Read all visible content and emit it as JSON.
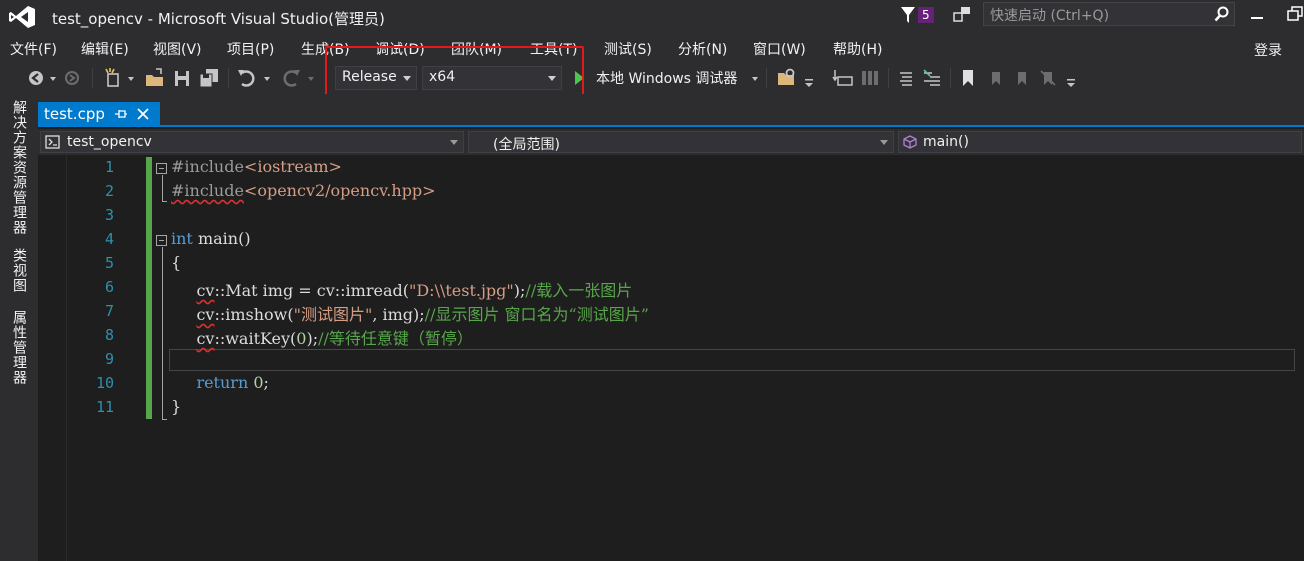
{
  "window": {
    "title": "test_opencv - Microsoft Visual Studio(管理员)",
    "notification_count": "5",
    "quick_launch_placeholder": "快速启动 (Ctrl+Q)"
  },
  "menu": {
    "items": [
      "文件(F)",
      "编辑(E)",
      "视图(V)",
      "项目(P)",
      "生成(B)",
      "调试(D)",
      "团队(M)",
      "工具(T)",
      "测试(S)",
      "分析(N)",
      "窗口(W)",
      "帮助(H)"
    ],
    "login": "登录"
  },
  "toolbar": {
    "configuration": "Release",
    "platform": "x64",
    "debugger": "本地 Windows 调试器"
  },
  "side_tabs": [
    "解决方案资源管理器",
    "类视图",
    "属性管理器"
  ],
  "tab": {
    "name": "test.cpp"
  },
  "nav": {
    "project": "test_opencv",
    "scope": "(全局范围)",
    "member": "main()"
  },
  "editor": {
    "line_numbers": [
      "1",
      "2",
      "3",
      "4",
      "5",
      "6",
      "7",
      "8",
      "9",
      "10",
      "11"
    ],
    "lines": [
      "#include<iostream>",
      "#include<opencv2/opencv.hpp>",
      "",
      "int main()",
      "{",
      "    cv::Mat img = cv::imread(\"D:\\\\test.jpg\");//载入一张图片",
      "    cv::imshow(\"测试图片\", img);//显示图片 窗口名为“测试图片”",
      "    cv::waitKey(0);//等待任意键（暂停）",
      "",
      "    return 0;",
      "}"
    ]
  },
  "colors": {
    "accent": "#007acc",
    "highlight_box": "#e8181a",
    "keyword": "#569cd6",
    "string": "#d69d85",
    "comment": "#57a64a",
    "line_number": "#2b91af"
  }
}
